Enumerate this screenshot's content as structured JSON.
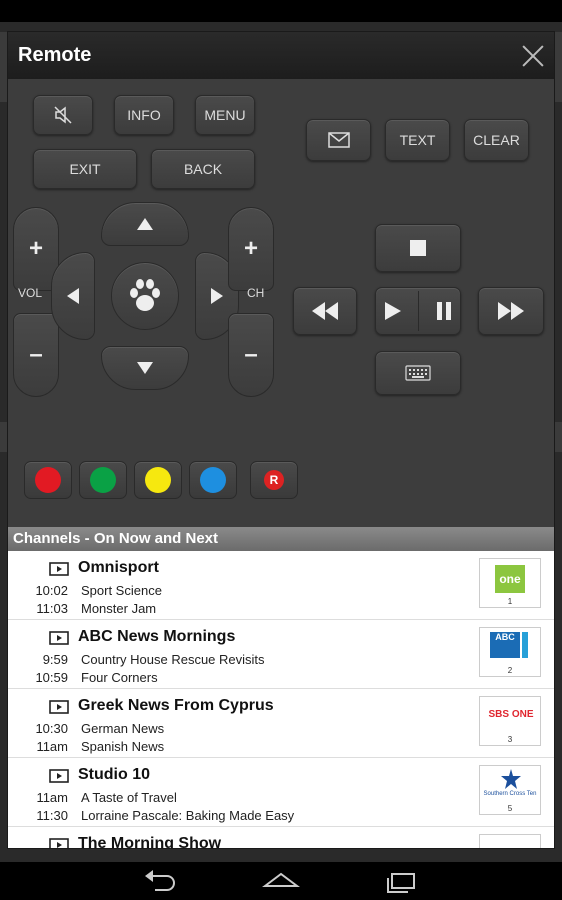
{
  "dialog": {
    "title": "Remote"
  },
  "remote": {
    "mute_icon": "mute-icon",
    "info_label": "INFO",
    "menu_label": "MENU",
    "exit_label": "EXIT",
    "back_label": "BACK",
    "mail_icon": "mail-icon",
    "text_label": "TEXT",
    "clear_label": "CLEAR",
    "vol_label": "VOL",
    "ch_label": "CH",
    "center_icon": "paw-icon",
    "colors": {
      "red": "#e21a23",
      "green": "#0aa145",
      "yellow": "#f6e80f",
      "blue": "#1e8fe0"
    },
    "r_label": "R"
  },
  "channels": {
    "header": "Channels - On Now and Next",
    "rows": [
      {
        "name": "Omnisport",
        "now_time": "10:02",
        "now_prog": "Sport Science",
        "next_time": "11:03",
        "next_prog": "Monster Jam",
        "logo_num": "1",
        "logo_text": "one"
      },
      {
        "name": "ABC News Mornings",
        "now_time": "9:59",
        "now_prog": "Country House Rescue Revisits",
        "next_time": "10:59",
        "next_prog": "Four Corners",
        "logo_num": "2",
        "logo_text": "ABC"
      },
      {
        "name": "Greek News From Cyprus",
        "now_time": "10:30",
        "now_prog": "German News",
        "next_time": "11am",
        "next_prog": "Spanish News",
        "logo_num": "3",
        "logo_text": "SBS ONE"
      },
      {
        "name": "Studio 10",
        "now_time": "11am",
        "now_prog": "A Taste of Travel",
        "next_time": "11:30",
        "next_prog": "Lorraine Pascale: Baking Made Easy",
        "logo_num": "5",
        "logo_text": "Southern Cross Ten"
      },
      {
        "name": "The Morning Show"
      }
    ]
  }
}
